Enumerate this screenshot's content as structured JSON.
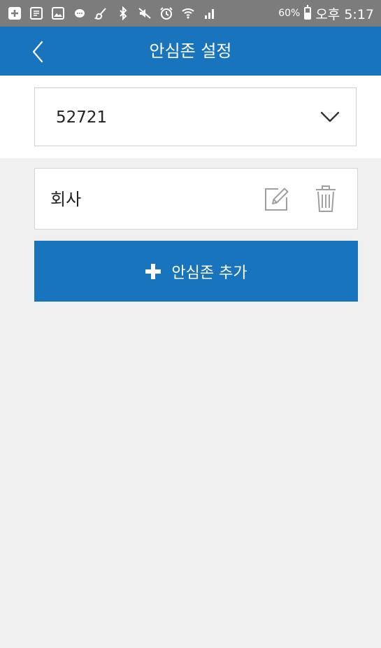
{
  "status_bar": {
    "icons": [
      "add-box-icon",
      "note-icon",
      "image-icon",
      "chat-bubble-icon",
      "broom-icon",
      "bluetooth-icon",
      "mute-icon",
      "alarm-icon",
      "wifi-icon",
      "signal-icon"
    ],
    "battery": "60%",
    "time": "오후 5:17"
  },
  "app_bar": {
    "title": "안심존 설정",
    "back_icon": "chevron-left-icon"
  },
  "device_selector": {
    "selected": "52721",
    "icon": "chevron-down-icon"
  },
  "zones": [
    {
      "name": "회사",
      "edit_icon": "edit-icon",
      "delete_icon": "trash-icon"
    }
  ],
  "add_button": {
    "label": "안심존 추가",
    "icon": "plus-icon"
  },
  "colors": {
    "status_bar": "#7c7c7c",
    "accent": "#1874bd",
    "background": "#f0f0f0",
    "icon_gray": "#a0a0a0"
  }
}
